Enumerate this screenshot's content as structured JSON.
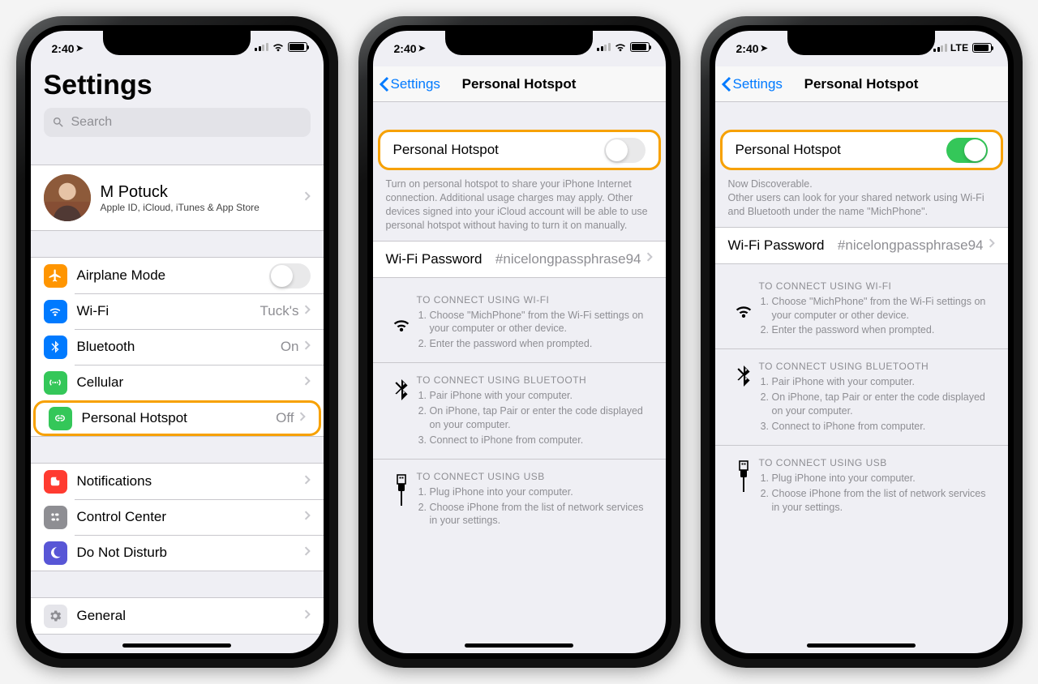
{
  "status": {
    "time": "2:40",
    "carrier": "LTE"
  },
  "screen1": {
    "title": "Settings",
    "search_placeholder": "Search",
    "apple_id": {
      "name": "M Potuck",
      "sub": "Apple ID, iCloud, iTunes & App Store"
    },
    "rows": {
      "airplane": "Airplane Mode",
      "wifi": {
        "label": "Wi-Fi",
        "value": "Tuck's"
      },
      "bt": {
        "label": "Bluetooth",
        "value": "On"
      },
      "cellular": "Cellular",
      "hotspot": {
        "label": "Personal Hotspot",
        "value": "Off"
      },
      "notif": "Notifications",
      "cc": "Control Center",
      "dnd": "Do Not Disturb",
      "general": "General"
    }
  },
  "hotspot": {
    "back": "Settings",
    "title": "Personal Hotspot",
    "row_label": "Personal Hotspot",
    "off_note": "Turn on personal hotspot to share your iPhone Internet connection. Additional usage charges may apply. Other devices signed into your iCloud account will be able to use personal hotspot without having to turn it on manually.",
    "on_note_1": "Now Discoverable.",
    "on_note_2": "Other users can look for your shared network using Wi-Fi and Bluetooth under the name \"MichPhone\".",
    "wifi_pw_label": "Wi-Fi Password",
    "wifi_pw_value": "#nicelongpassphrase94",
    "wifi_instr": {
      "title": "TO CONNECT USING WI-FI",
      "s1": "Choose \"MichPhone\" from the Wi-Fi settings on your computer or other device.",
      "s2": "Enter the password when prompted."
    },
    "bt_instr": {
      "title": "TO CONNECT USING BLUETOOTH",
      "s1": "Pair iPhone with your computer.",
      "s2": "On iPhone, tap Pair or enter the code displayed on your computer.",
      "s3": "Connect to iPhone from computer."
    },
    "usb_instr": {
      "title": "TO CONNECT USING USB",
      "s1": "Plug iPhone into your computer.",
      "s2": "Choose iPhone from the list of network services in your settings."
    }
  }
}
